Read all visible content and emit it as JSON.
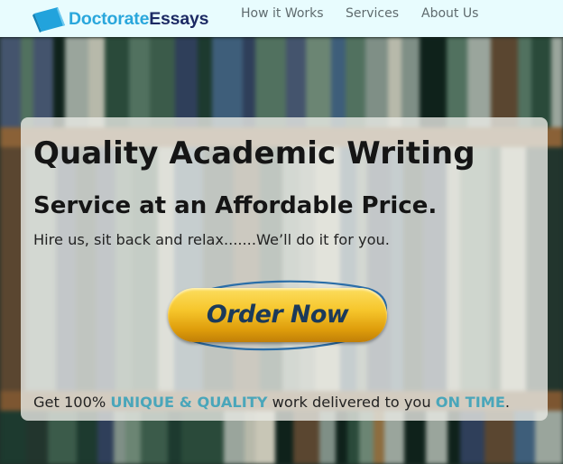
{
  "header": {
    "brand_part1": "Doctorate",
    "brand_part2": "Essays",
    "nav": [
      "How it Works",
      "Services",
      "About Us"
    ]
  },
  "hero": {
    "title": "Quality Academic Writing",
    "subtitle": "Service at an Affordable Price.",
    "tagline": "Hire us, sit back and relax.......We’ll do it for you.",
    "order_button": "Order Now",
    "footer": {
      "prefix": "Get 100% ",
      "highlight1": "UNIQUE & QUALITY",
      "middle": " work delivered to you ",
      "highlight2": "ON TIME",
      "suffix": "."
    }
  },
  "colors": {
    "header_bg": "#e8fcfe",
    "brand_light": "#2aa7dc",
    "brand_dark": "#1c2a64",
    "highlight": "#4aa6ba",
    "button_gold": "#f6c52b",
    "button_text": "#1b3a5a"
  },
  "icons": [
    "book-logo-icon"
  ]
}
